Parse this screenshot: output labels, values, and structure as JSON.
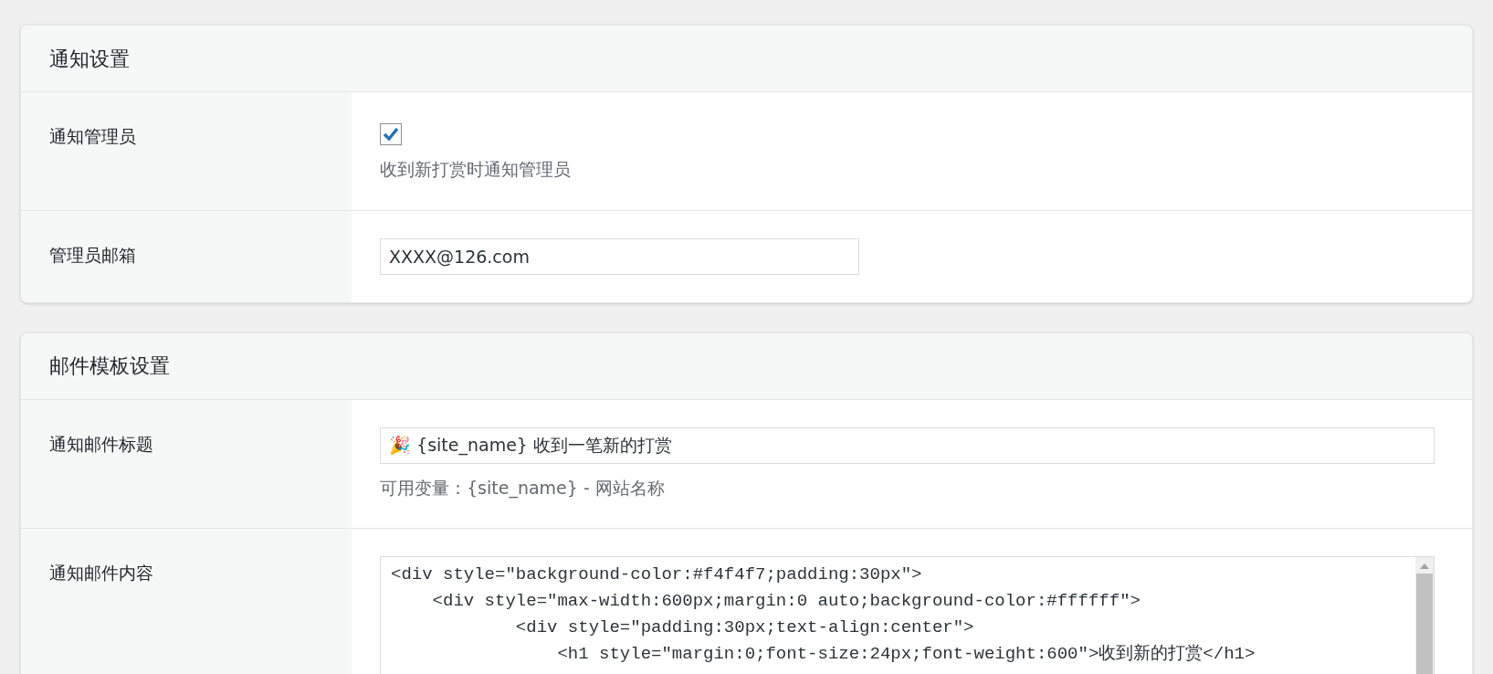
{
  "sections": [
    {
      "title": "通知设置",
      "rows": [
        {
          "kind": "checkbox",
          "label": "通知管理员",
          "checked": true,
          "description": "收到新打赏时通知管理员"
        },
        {
          "kind": "text",
          "label": "管理员邮箱",
          "value": "XXXX@126.com",
          "wide": false
        }
      ]
    },
    {
      "title": "邮件模板设置",
      "rows": [
        {
          "kind": "text",
          "label": "通知邮件标题",
          "value": "🎉 {site_name} 收到一笔新的打赏",
          "wide": true,
          "description": "可用变量：{site_name} - 网站名称"
        },
        {
          "kind": "textarea",
          "label": "通知邮件内容",
          "lines": [
            "<div style=\"background-color:#f4f4f7;padding:30px\">",
            "    <div style=\"max-width:600px;margin:0 auto;background-color:#ffffff\">",
            "            <div style=\"padding:30px;text-align:center\">",
            "                <h1 style=\"margin:0;font-size:24px;font-weight:600\">收到新的打赏</h1>"
          ]
        }
      ]
    }
  ]
}
